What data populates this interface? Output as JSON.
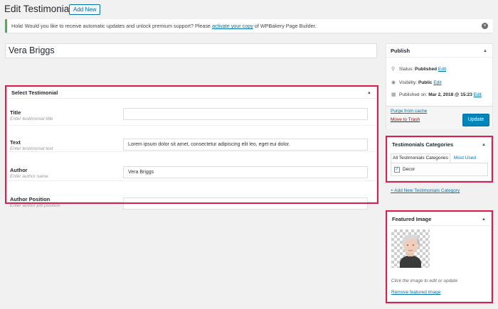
{
  "header": {
    "title": "Edit Testimonial",
    "add_new": "Add New"
  },
  "notice": {
    "prefix": "Hola! Would you like to receive automatic updates and unlock premium support? Please ",
    "link": "activate your copy",
    "suffix": " of WPBakery Page Builder."
  },
  "post_title": "Vera Briggs",
  "select_box": {
    "title": "Select Testimonial",
    "fields": [
      {
        "label": "Title",
        "hint": "Enter testimonial title",
        "value": ""
      },
      {
        "label": "Text",
        "hint": "Enter testimonial text",
        "value": "Lorem ipsum dolor sit amet, consectetur adipiscing elit  leo, eget eui dolor."
      },
      {
        "label": "Author",
        "hint": "Enter author name",
        "value": "Vera Briggs"
      },
      {
        "label": "Author Position",
        "hint": "Enter author job position",
        "value": ""
      }
    ]
  },
  "publish": {
    "title": "Publish",
    "status_label": "Status:",
    "status_value": "Published",
    "visibility_label": "Visibility:",
    "visibility_value": "Public",
    "published_label": "Published on:",
    "published_value": "Mar 2, 2018 @ 15:23",
    "edit": "Edit",
    "purge": "Purge from cache",
    "trash": "Move to Trash",
    "update": "Update"
  },
  "categories": {
    "title": "Testimonials Categories",
    "tab_all": "All Testimonials Categories",
    "tab_most_used": "Most Used",
    "items": [
      {
        "label": "Decor",
        "checked": true
      }
    ],
    "add_new": "+ Add New Testimonials Category"
  },
  "featured": {
    "title": "Featured Image",
    "caption": "Click the image to edit or update",
    "remove": "Remove featured image"
  },
  "colors": {
    "accent": "#d8204f",
    "link": "#0073aa",
    "primary_button": "#0085ba",
    "notice_border": "#46b450"
  }
}
